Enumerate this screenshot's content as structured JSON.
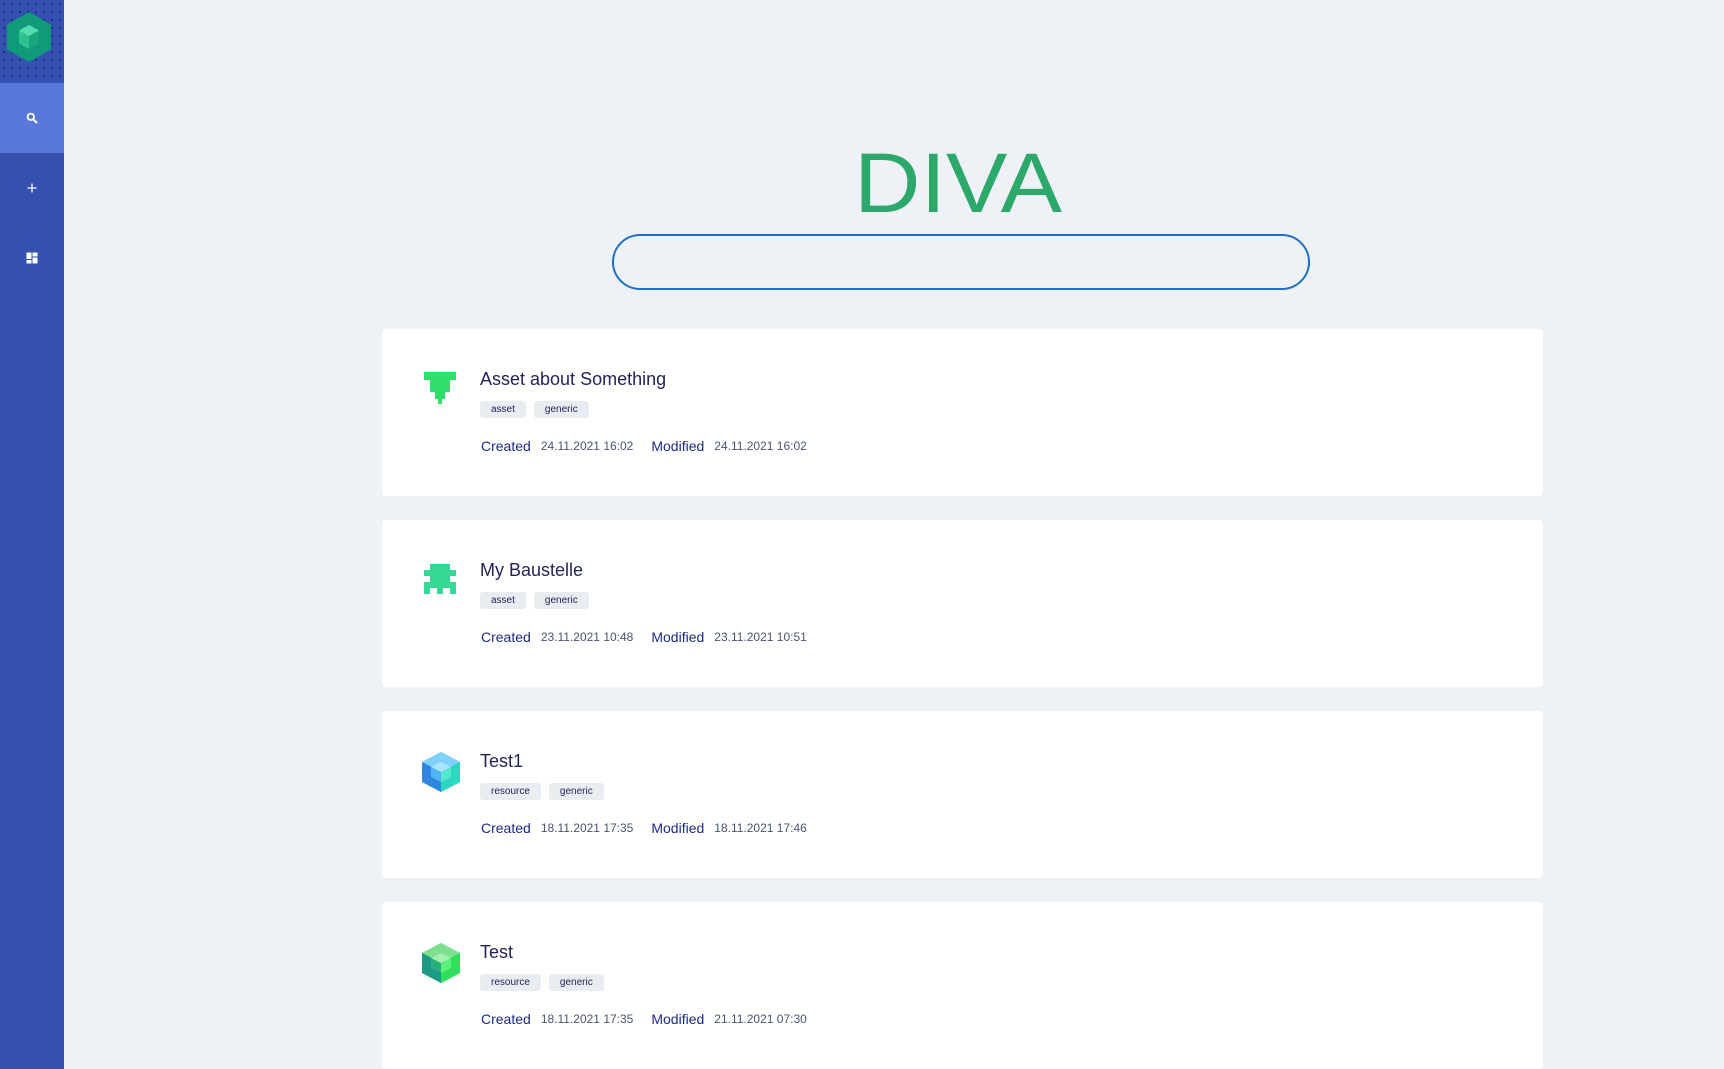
{
  "app": {
    "brand": "DIVA",
    "colors": {
      "sidebar": "#3451b2",
      "sidebar_active": "#5a77dc",
      "brand_green": "#2ca86a",
      "search_border": "#1f6fc7",
      "text_dark": "#23235a"
    }
  },
  "sidebar": {
    "logo_icon": "hexagon-logo-icon",
    "items": [
      {
        "name": "search",
        "icon": "search-icon",
        "active": true
      },
      {
        "name": "create",
        "icon": "plus-icon",
        "active": false
      },
      {
        "name": "dashboard",
        "icon": "dashboard-icon",
        "active": false
      }
    ]
  },
  "search": {
    "value": "",
    "placeholder": ""
  },
  "results": [
    {
      "title": "Asset about Something",
      "icon": "asset-identicon-icon",
      "tags": [
        "asset",
        "generic"
      ],
      "created_label": "Created",
      "created": "24.11.2021 16:02",
      "modified_label": "Modified",
      "modified": "24.11.2021 16:02"
    },
    {
      "title": "My Baustelle",
      "icon": "asset-identicon-icon",
      "tags": [
        "asset",
        "generic"
      ],
      "created_label": "Created",
      "created": "23.11.2021 10:48",
      "modified_label": "Modified",
      "modified": "23.11.2021 10:51"
    },
    {
      "title": "Test1",
      "icon": "resource-cube-icon",
      "tags": [
        "resource",
        "generic"
      ],
      "created_label": "Created",
      "created": "18.11.2021 17:35",
      "modified_label": "Modified",
      "modified": "18.11.2021 17:46"
    },
    {
      "title": "Test",
      "icon": "resource-cube-icon",
      "tags": [
        "resource",
        "generic"
      ],
      "created_label": "Created",
      "created": "18.11.2021 17:35",
      "modified_label": "Modified",
      "modified": "21.11.2021 07:30"
    }
  ]
}
